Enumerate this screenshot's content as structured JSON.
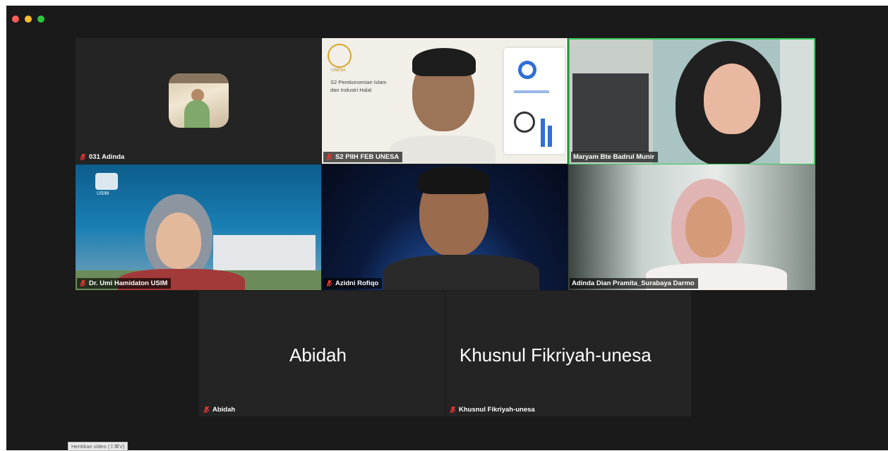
{
  "participants": [
    {
      "name": "031 Adinda"
    },
    {
      "name": "S2 PIIH FEB UNESA"
    },
    {
      "name": "Maryam Bte Badrul Munir"
    },
    {
      "name": "Dr. Umi Hamidaton USIM"
    },
    {
      "name": "Azidni Rofiqo"
    },
    {
      "name": "Adinda Dian Pramita_Surabaya Darmo"
    },
    {
      "name": "Abidah",
      "display": "Abidah"
    },
    {
      "name": "Khusnul Fikriyah-unesa",
      "display": "Khusnul Fikriyah-unesa"
    }
  ],
  "unesa_slide": {
    "logo_text": "UNESA",
    "line1": "S2 Perekonomian Islam",
    "line2": "dan Industri Halal"
  },
  "usim_logo": "USIM",
  "stop_video_button": "Hentikan video (⇧⌘V)",
  "colors": {
    "active_speaker": "#39c65a",
    "mic_muted": "#e53935"
  }
}
